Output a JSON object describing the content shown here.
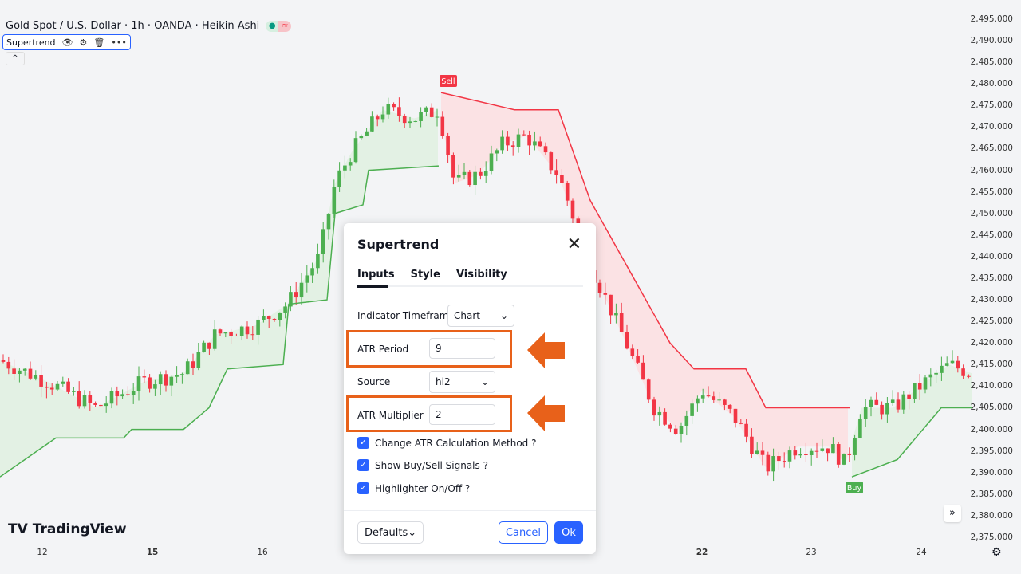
{
  "header": {
    "symbol_title": "Gold Spot / U.S. Dollar · 1h · OANDA · Heikin Ashi",
    "indicator_name": "Supertrend"
  },
  "colors": {
    "up": "#4caf50",
    "down": "#f23645",
    "accent": "#2962ff",
    "highlight": "#e8611a",
    "uptrend_fill": "#e3f1e4",
    "downtrend_fill": "#fbe2e4"
  },
  "brand": "TradingView",
  "price_axis": [
    "2,495.000",
    "2,490.000",
    "2,485.000",
    "2,480.000",
    "2,475.000",
    "2,470.000",
    "2,465.000",
    "2,460.000",
    "2,455.000",
    "2,450.000",
    "2,445.000",
    "2,440.000",
    "2,435.000",
    "2,430.000",
    "2,425.000",
    "2,420.000",
    "2,415.000",
    "2,410.000",
    "2,405.000",
    "2,400.000",
    "2,395.000",
    "2,390.000",
    "2,385.000",
    "2,380.000",
    "2,375.000"
  ],
  "time_axis": [
    {
      "label": "12",
      "bold": false
    },
    {
      "label": "15",
      "bold": true
    },
    {
      "label": "16",
      "bold": false
    },
    {
      "label": "22",
      "bold": true
    },
    {
      "label": "23",
      "bold": false
    },
    {
      "label": "24",
      "bold": false
    }
  ],
  "signals": {
    "sell": "Sell",
    "buy": "Buy"
  },
  "chart_data": {
    "type": "candlestick",
    "ylim": [
      2375,
      2495
    ],
    "price_path": [
      [
        0,
        2416
      ],
      [
        60,
        2411
      ],
      [
        120,
        2405
      ],
      [
        180,
        2411
      ],
      [
        230,
        2413
      ],
      [
        270,
        2422
      ],
      [
        320,
        2424
      ],
      [
        360,
        2429
      ],
      [
        400,
        2440
      ],
      [
        420,
        2457
      ],
      [
        440,
        2464
      ],
      [
        480,
        2474
      ],
      [
        520,
        2472
      ],
      [
        550,
        2474
      ],
      [
        570,
        2457
      ],
      [
        600,
        2459
      ],
      [
        630,
        2466
      ],
      [
        660,
        2468
      ],
      [
        700,
        2459
      ],
      [
        740,
        2438
      ],
      [
        780,
        2422
      ],
      [
        820,
        2405
      ],
      [
        850,
        2400
      ],
      [
        880,
        2409
      ],
      [
        920,
        2403
      ],
      [
        960,
        2391
      ],
      [
        1000,
        2396
      ],
      [
        1040,
        2396
      ],
      [
        1060,
        2392
      ],
      [
        1080,
        2405
      ],
      [
        1120,
        2405
      ],
      [
        1160,
        2411
      ],
      [
        1190,
        2415
      ],
      [
        1218,
        2413
      ]
    ],
    "supertrend_up_1": [
      [
        0,
        2389
      ],
      [
        70,
        2398
      ],
      [
        155,
        2398
      ],
      [
        165,
        2400
      ],
      [
        230,
        2400
      ],
      [
        262,
        2405
      ],
      [
        285,
        2414
      ],
      [
        355,
        2415
      ],
      [
        362,
        2429
      ],
      [
        410,
        2430
      ],
      [
        420,
        2450
      ],
      [
        455,
        2452
      ],
      [
        462,
        2460
      ],
      [
        550,
        2461
      ]
    ],
    "supertrend_down": [
      [
        553,
        2478
      ],
      [
        645,
        2474
      ],
      [
        700,
        2474
      ],
      [
        740,
        2453
      ],
      [
        840,
        2420
      ],
      [
        870,
        2414
      ],
      [
        935,
        2414
      ],
      [
        960,
        2405
      ],
      [
        1065,
        2405
      ]
    ],
    "supertrend_up_2": [
      [
        1068,
        2389
      ],
      [
        1125,
        2393
      ],
      [
        1180,
        2405
      ],
      [
        1218,
        2405
      ]
    ]
  },
  "dialog": {
    "title": "Supertrend",
    "tabs": [
      "Inputs",
      "Style",
      "Visibility"
    ],
    "active_tab": "Inputs",
    "timeframe_label": "Indicator Timeframe",
    "timeframe_value": "Chart",
    "atr_period_label": "ATR Period",
    "atr_period_value": "9",
    "source_label": "Source",
    "source_value": "hl2",
    "atr_multiplier_label": "ATR Multiplier",
    "atr_multiplier_value": "2",
    "checkboxes": [
      {
        "label": "Change ATR Calculation Method ?",
        "checked": true
      },
      {
        "label": "Show Buy/Sell Signals ?",
        "checked": true
      },
      {
        "label": "Highlighter On/Off ?",
        "checked": true
      }
    ],
    "defaults_label": "Defaults",
    "cancel_label": "Cancel",
    "ok_label": "Ok"
  }
}
